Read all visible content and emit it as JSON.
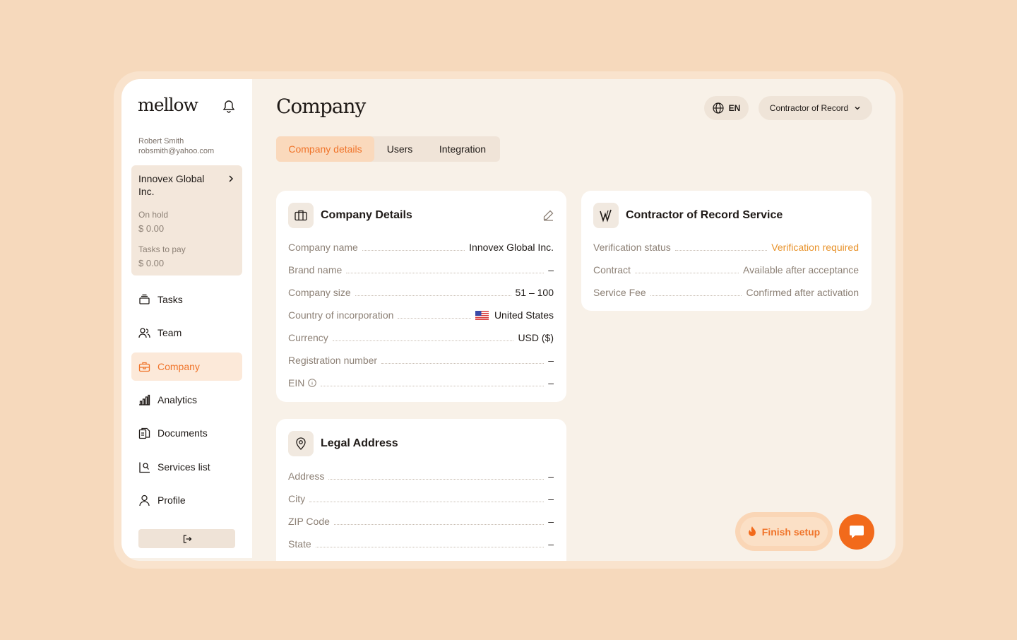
{
  "brand": {
    "logo": "mellow"
  },
  "user": {
    "name": "Robert Smith",
    "email": "robsmith@yahoo.com"
  },
  "org": {
    "name": "Innovex Global Inc.",
    "on_hold_label": "On hold",
    "on_hold_value": "$ 0.00",
    "tasks_label": "Tasks to pay",
    "tasks_value": "$ 0.00"
  },
  "nav": [
    {
      "label": "Tasks",
      "icon": "tasks-icon",
      "active": false
    },
    {
      "label": "Team",
      "icon": "team-icon",
      "active": false
    },
    {
      "label": "Company",
      "icon": "company-icon",
      "active": true
    },
    {
      "label": "Analytics",
      "icon": "analytics-icon",
      "active": false
    },
    {
      "label": "Documents",
      "icon": "documents-icon",
      "active": false
    },
    {
      "label": "Services list",
      "icon": "services-icon",
      "active": false
    },
    {
      "label": "Profile",
      "icon": "profile-icon",
      "active": false
    }
  ],
  "header": {
    "title": "Company",
    "language": "EN",
    "mode": "Contractor of Record"
  },
  "tabs": [
    {
      "label": "Company details",
      "active": true
    },
    {
      "label": "Users",
      "active": false
    },
    {
      "label": "Integration",
      "active": false
    }
  ],
  "company_details": {
    "title": "Company Details",
    "rows": [
      {
        "label": "Company name",
        "value": "Innovex Global Inc."
      },
      {
        "label": "Brand name",
        "value": "–"
      },
      {
        "label": "Company size",
        "value": "51 – 100"
      },
      {
        "label": "Country of incorporation",
        "value": "United States"
      },
      {
        "label": "Currency",
        "value": "USD ($)"
      },
      {
        "label": "Registration number",
        "value": "–"
      },
      {
        "label": "EIN",
        "value": "–"
      }
    ]
  },
  "cor_service": {
    "title": "Contractor of Record Service",
    "rows": [
      {
        "label": "Verification status",
        "value": "Verification required"
      },
      {
        "label": "Contract",
        "value": "Available after acceptance"
      },
      {
        "label": "Service Fee",
        "value": "Confirmed after activation"
      }
    ]
  },
  "legal_address": {
    "title": "Legal Address",
    "rows": [
      {
        "label": "Address",
        "value": "–"
      },
      {
        "label": "City",
        "value": "–"
      },
      {
        "label": "ZIP Code",
        "value": "–"
      },
      {
        "label": "State",
        "value": "–"
      }
    ]
  },
  "actions": {
    "finish_setup": "Finish setup"
  },
  "colors": {
    "accent": "#f0742a",
    "warning": "#e8922a",
    "background": "#f6d9bc"
  }
}
